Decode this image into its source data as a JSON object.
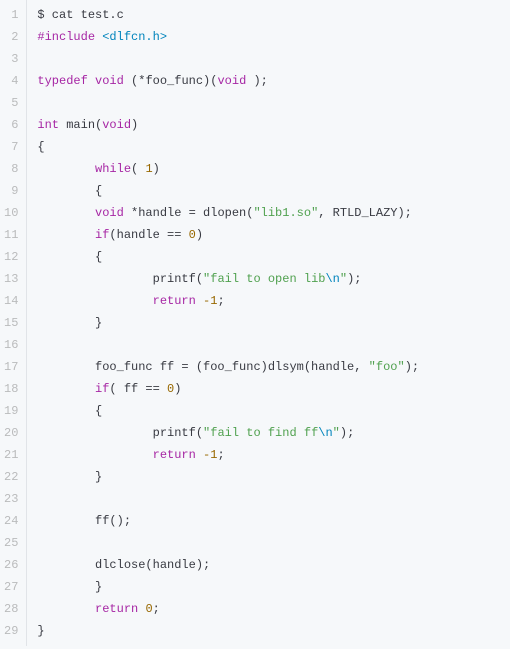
{
  "code": {
    "lines": [
      [
        {
          "c": "tok-plain",
          "t": "$ cat test.c"
        }
      ],
      [
        {
          "c": "tok-pp",
          "t": "#include"
        },
        {
          "c": "tok-plain",
          "t": " "
        },
        {
          "c": "tok-inc",
          "t": "<dlfcn.h>"
        }
      ],
      [
        {
          "c": "tok-plain",
          "t": ""
        }
      ],
      [
        {
          "c": "tok-kw",
          "t": "typedef"
        },
        {
          "c": "tok-plain",
          "t": " "
        },
        {
          "c": "tok-kw",
          "t": "void"
        },
        {
          "c": "tok-plain",
          "t": " (*foo_func)("
        },
        {
          "c": "tok-kw",
          "t": "void"
        },
        {
          "c": "tok-plain",
          "t": " );"
        }
      ],
      [
        {
          "c": "tok-plain",
          "t": ""
        }
      ],
      [
        {
          "c": "tok-kw",
          "t": "int"
        },
        {
          "c": "tok-plain",
          "t": " "
        },
        {
          "c": "tok-fn",
          "t": "main"
        },
        {
          "c": "tok-plain",
          "t": "("
        },
        {
          "c": "tok-kw",
          "t": "void"
        },
        {
          "c": "tok-plain",
          "t": ")"
        }
      ],
      [
        {
          "c": "tok-plain",
          "t": "{"
        }
      ],
      [
        {
          "c": "tok-plain",
          "t": "        "
        },
        {
          "c": "tok-kw",
          "t": "while"
        },
        {
          "c": "tok-plain",
          "t": "( "
        },
        {
          "c": "tok-num",
          "t": "1"
        },
        {
          "c": "tok-plain",
          "t": ")"
        }
      ],
      [
        {
          "c": "tok-plain",
          "t": "        {"
        }
      ],
      [
        {
          "c": "tok-plain",
          "t": "        "
        },
        {
          "c": "tok-kw",
          "t": "void"
        },
        {
          "c": "tok-plain",
          "t": " *handle = dlopen("
        },
        {
          "c": "tok-str",
          "t": "\"lib1.so\""
        },
        {
          "c": "tok-plain",
          "t": ", RTLD_LAZY);"
        }
      ],
      [
        {
          "c": "tok-plain",
          "t": "        "
        },
        {
          "c": "tok-kw",
          "t": "if"
        },
        {
          "c": "tok-plain",
          "t": "(handle == "
        },
        {
          "c": "tok-num",
          "t": "0"
        },
        {
          "c": "tok-plain",
          "t": ")"
        }
      ],
      [
        {
          "c": "tok-plain",
          "t": "        {"
        }
      ],
      [
        {
          "c": "tok-plain",
          "t": "                printf("
        },
        {
          "c": "tok-str",
          "t": "\"fail to open lib"
        },
        {
          "c": "tok-esc",
          "t": "\\n"
        },
        {
          "c": "tok-str",
          "t": "\""
        },
        {
          "c": "tok-plain",
          "t": ");"
        }
      ],
      [
        {
          "c": "tok-plain",
          "t": "                "
        },
        {
          "c": "tok-kw",
          "t": "return"
        },
        {
          "c": "tok-plain",
          "t": " "
        },
        {
          "c": "tok-num",
          "t": "-1"
        },
        {
          "c": "tok-plain",
          "t": ";"
        }
      ],
      [
        {
          "c": "tok-plain",
          "t": "        }"
        }
      ],
      [
        {
          "c": "tok-plain",
          "t": ""
        }
      ],
      [
        {
          "c": "tok-plain",
          "t": "        foo_func ff = (foo_func)dlsym(handle, "
        },
        {
          "c": "tok-str",
          "t": "\"foo\""
        },
        {
          "c": "tok-plain",
          "t": ");"
        }
      ],
      [
        {
          "c": "tok-plain",
          "t": "        "
        },
        {
          "c": "tok-kw",
          "t": "if"
        },
        {
          "c": "tok-plain",
          "t": "( ff == "
        },
        {
          "c": "tok-num",
          "t": "0"
        },
        {
          "c": "tok-plain",
          "t": ")"
        }
      ],
      [
        {
          "c": "tok-plain",
          "t": "        {"
        }
      ],
      [
        {
          "c": "tok-plain",
          "t": "                printf("
        },
        {
          "c": "tok-str",
          "t": "\"fail to find ff"
        },
        {
          "c": "tok-esc",
          "t": "\\n"
        },
        {
          "c": "tok-str",
          "t": "\""
        },
        {
          "c": "tok-plain",
          "t": ");"
        }
      ],
      [
        {
          "c": "tok-plain",
          "t": "                "
        },
        {
          "c": "tok-kw",
          "t": "return"
        },
        {
          "c": "tok-plain",
          "t": " "
        },
        {
          "c": "tok-num",
          "t": "-1"
        },
        {
          "c": "tok-plain",
          "t": ";"
        }
      ],
      [
        {
          "c": "tok-plain",
          "t": "        }"
        }
      ],
      [
        {
          "c": "tok-plain",
          "t": ""
        }
      ],
      [
        {
          "c": "tok-plain",
          "t": "        ff();"
        }
      ],
      [
        {
          "c": "tok-plain",
          "t": ""
        }
      ],
      [
        {
          "c": "tok-plain",
          "t": "        dlclose(handle);"
        }
      ],
      [
        {
          "c": "tok-plain",
          "t": "        }"
        }
      ],
      [
        {
          "c": "tok-plain",
          "t": "        "
        },
        {
          "c": "tok-kw",
          "t": "return"
        },
        {
          "c": "tok-plain",
          "t": " "
        },
        {
          "c": "tok-num",
          "t": "0"
        },
        {
          "c": "tok-plain",
          "t": ";"
        }
      ],
      [
        {
          "c": "tok-plain",
          "t": "}"
        }
      ]
    ]
  }
}
